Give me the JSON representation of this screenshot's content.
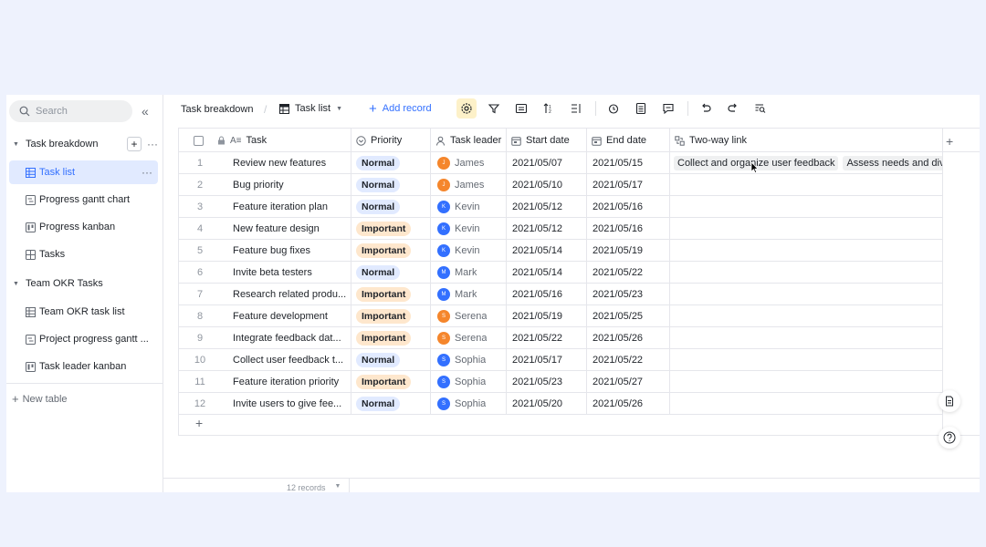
{
  "sidebar": {
    "search_placeholder": "Search",
    "groups": [
      {
        "label": "Task breakdown"
      },
      {
        "label": "Team OKR Tasks"
      }
    ],
    "items": [
      {
        "label": "Task list",
        "icon": "grid-icon"
      },
      {
        "label": "Progress gantt chart",
        "icon": "gantt-icon"
      },
      {
        "label": "Progress kanban",
        "icon": "kanban-icon"
      },
      {
        "label": "Tasks",
        "icon": "form-icon"
      },
      {
        "label": "Team OKR task list",
        "icon": "grid-icon"
      },
      {
        "label": "Project progress gantt ...",
        "icon": "gantt-icon"
      },
      {
        "label": "Task leader kanban",
        "icon": "kanban-icon"
      }
    ],
    "new_table": "New table"
  },
  "toolbar": {
    "breadcrumb": "Task breakdown",
    "separator": "/",
    "view": "Task list",
    "add_record": "Add record"
  },
  "table": {
    "columns": [
      "Task",
      "Priority",
      "Task leader",
      "Start date",
      "End date",
      "Two-way link"
    ],
    "rows": [
      {
        "n": "1",
        "task": "Review new features",
        "priority": "Normal",
        "leader": "James",
        "initial": "J",
        "color": "#f5862c",
        "start": "2021/05/07",
        "end": "2021/05/15",
        "links": [
          "Collect and organize user feedback",
          "Assess needs and div"
        ]
      },
      {
        "n": "2",
        "task": "Bug priority",
        "priority": "Normal",
        "leader": "James",
        "initial": "J",
        "color": "#f5862c",
        "start": "2021/05/10",
        "end": "2021/05/17",
        "links": []
      },
      {
        "n": "3",
        "task": "Feature iteration plan",
        "priority": "Normal",
        "leader": "Kevin",
        "initial": "K",
        "color": "#3370ff",
        "start": "2021/05/12",
        "end": "2021/05/16",
        "links": []
      },
      {
        "n": "4",
        "task": "New feature design",
        "priority": "Important",
        "leader": "Kevin",
        "initial": "K",
        "color": "#3370ff",
        "start": "2021/05/12",
        "end": "2021/05/16",
        "links": []
      },
      {
        "n": "5",
        "task": "Feature bug fixes",
        "priority": "Important",
        "leader": "Kevin",
        "initial": "K",
        "color": "#3370ff",
        "start": "2021/05/14",
        "end": "2021/05/19",
        "links": []
      },
      {
        "n": "6",
        "task": "Invite beta testers",
        "priority": "Normal",
        "leader": "Mark",
        "initial": "M",
        "color": "#3370ff",
        "start": "2021/05/14",
        "end": "2021/05/22",
        "links": []
      },
      {
        "n": "7",
        "task": "Research related produ...",
        "priority": "Important",
        "leader": "Mark",
        "initial": "M",
        "color": "#3370ff",
        "start": "2021/05/16",
        "end": "2021/05/23",
        "links": []
      },
      {
        "n": "8",
        "task": "Feature development",
        "priority": "Important",
        "leader": "Serena",
        "initial": "S",
        "color": "#f5862c",
        "start": "2021/05/19",
        "end": "2021/05/25",
        "links": []
      },
      {
        "n": "9",
        "task": "Integrate feedback dat...",
        "priority": "Important",
        "leader": "Serena",
        "initial": "S",
        "color": "#f5862c",
        "start": "2021/05/22",
        "end": "2021/05/26",
        "links": []
      },
      {
        "n": "10",
        "task": "Collect user feedback t...",
        "priority": "Normal",
        "leader": "Sophia",
        "initial": "S",
        "color": "#3370ff",
        "start": "2021/05/17",
        "end": "2021/05/22",
        "links": []
      },
      {
        "n": "11",
        "task": "Feature iteration priority",
        "priority": "Important",
        "leader": "Sophia",
        "initial": "S",
        "color": "#3370ff",
        "start": "2021/05/23",
        "end": "2021/05/27",
        "links": []
      },
      {
        "n": "12",
        "task": "Invite users to give fee...",
        "priority": "Normal",
        "leader": "Sophia",
        "initial": "S",
        "color": "#3370ff",
        "start": "2021/05/20",
        "end": "2021/05/26",
        "links": []
      }
    ]
  },
  "footer": {
    "records": "12 records"
  },
  "colors": {
    "normal_bg": "#e1eaff",
    "normal_fg": "#1f2329",
    "important_bg": "#fee7cd",
    "important_fg": "#1f2329",
    "accent": "#3370ff"
  }
}
